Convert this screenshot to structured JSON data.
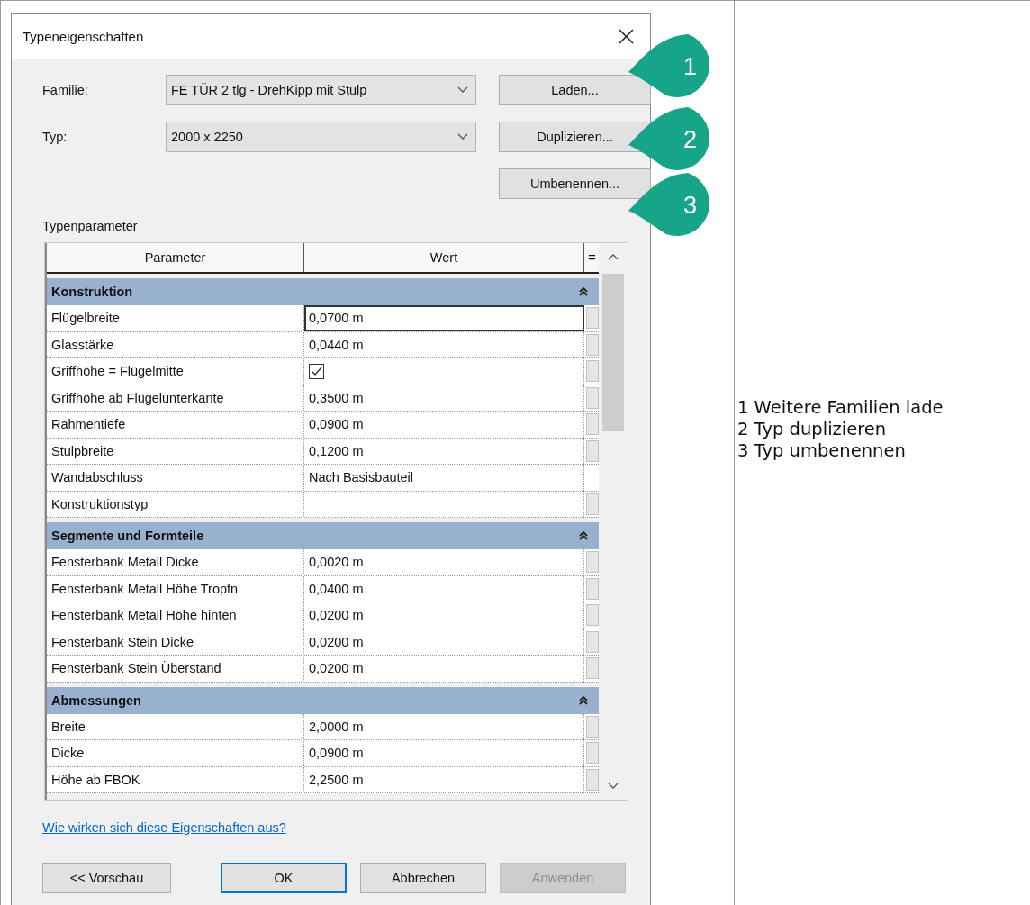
{
  "dialog": {
    "title": "Typeneigenschaften",
    "fields": [
      {
        "label": "Familie:",
        "value": "FE TÜR 2 tlg - DrehKipp mit Stulp"
      },
      {
        "label": "Typ:",
        "value": "2000 x 2250"
      }
    ],
    "side_buttons": [
      "Laden...",
      "Duplizieren...",
      "Umbenennen..."
    ],
    "section_label": "Typenparameter",
    "table": {
      "columns": [
        "Parameter",
        "Wert",
        "="
      ],
      "groups": [
        {
          "name": "Konstruktion",
          "expanded": true,
          "rows": [
            {
              "parameter": "Flügelbreite",
              "kind": "text",
              "value": "0,0700 m",
              "selected": true,
              "link_button": true
            },
            {
              "parameter": "Glasstärke",
              "kind": "text",
              "value": "0,0440 m",
              "selected": false,
              "link_button": true
            },
            {
              "parameter": "Griffhöhe = Flügelmitte",
              "kind": "checkbox",
              "checked": true,
              "selected": false,
              "link_button": true
            },
            {
              "parameter": "Griffhöhe ab Flügelunterkante",
              "kind": "text",
              "value": "0,3500 m",
              "selected": false,
              "link_button": true
            },
            {
              "parameter": "Rahmentiefe",
              "kind": "text",
              "value": "0,0900 m",
              "selected": false,
              "link_button": true
            },
            {
              "parameter": "Stulpbreite",
              "kind": "text",
              "value": "0,1200 m",
              "selected": false,
              "link_button": true
            },
            {
              "parameter": "Wandabschluss",
              "kind": "text",
              "value": "Nach Basisbauteil",
              "selected": false,
              "link_button": false
            },
            {
              "parameter": "Konstruktionstyp",
              "kind": "text",
              "selected": false,
              "link_button": true
            }
          ]
        },
        {
          "name": "Segmente und Formteile",
          "expanded": true,
          "rows": [
            {
              "parameter": "Fensterbank Metall Dicke",
              "kind": "text",
              "value": "0,0020 m",
              "selected": false,
              "link_button": true
            },
            {
              "parameter": "Fensterbank Metall Höhe Tropfn",
              "kind": "text",
              "value": "0,0400 m",
              "selected": false,
              "link_button": true
            },
            {
              "parameter": "Fensterbank Metall Höhe hinten",
              "kind": "text",
              "value": "0,0200 m",
              "selected": false,
              "link_button": true
            },
            {
              "parameter": "Fensterbank Stein Dicke",
              "kind": "text",
              "value": "0,0200 m",
              "selected": false,
              "link_button": true
            },
            {
              "parameter": "Fensterbank Stein Überstand",
              "kind": "text",
              "value": "0,0200 m",
              "selected": false,
              "link_button": true
            }
          ]
        },
        {
          "name": "Abmessungen",
          "expanded": true,
          "rows": [
            {
              "parameter": "Breite",
              "kind": "text",
              "value": "2,0000 m",
              "selected": false,
              "link_button": true
            },
            {
              "parameter": "Dicke",
              "kind": "text",
              "value": "0,0900 m",
              "selected": false,
              "link_button": true
            },
            {
              "parameter": "Höhe ab FBOK",
              "kind": "text",
              "value": "2,2500 m",
              "selected": false,
              "link_button": true
            }
          ]
        }
      ]
    },
    "link": "Wie wirken sich diese Eigenschaften aus?",
    "footer_buttons": [
      {
        "label": "<< Vorschau",
        "default": false,
        "disabled": false
      },
      {
        "label": "OK",
        "default": true,
        "disabled": false
      },
      {
        "label": "Abbrechen",
        "default": false,
        "disabled": false
      },
      {
        "label": "Anwenden",
        "default": false,
        "disabled": true
      }
    ]
  },
  "callouts": [
    "1",
    "2",
    "3"
  ],
  "notes": [
    "1 Weitere Familien lade",
    "2 Typ duplizieren",
    "3 Typ umbenennen"
  ]
}
